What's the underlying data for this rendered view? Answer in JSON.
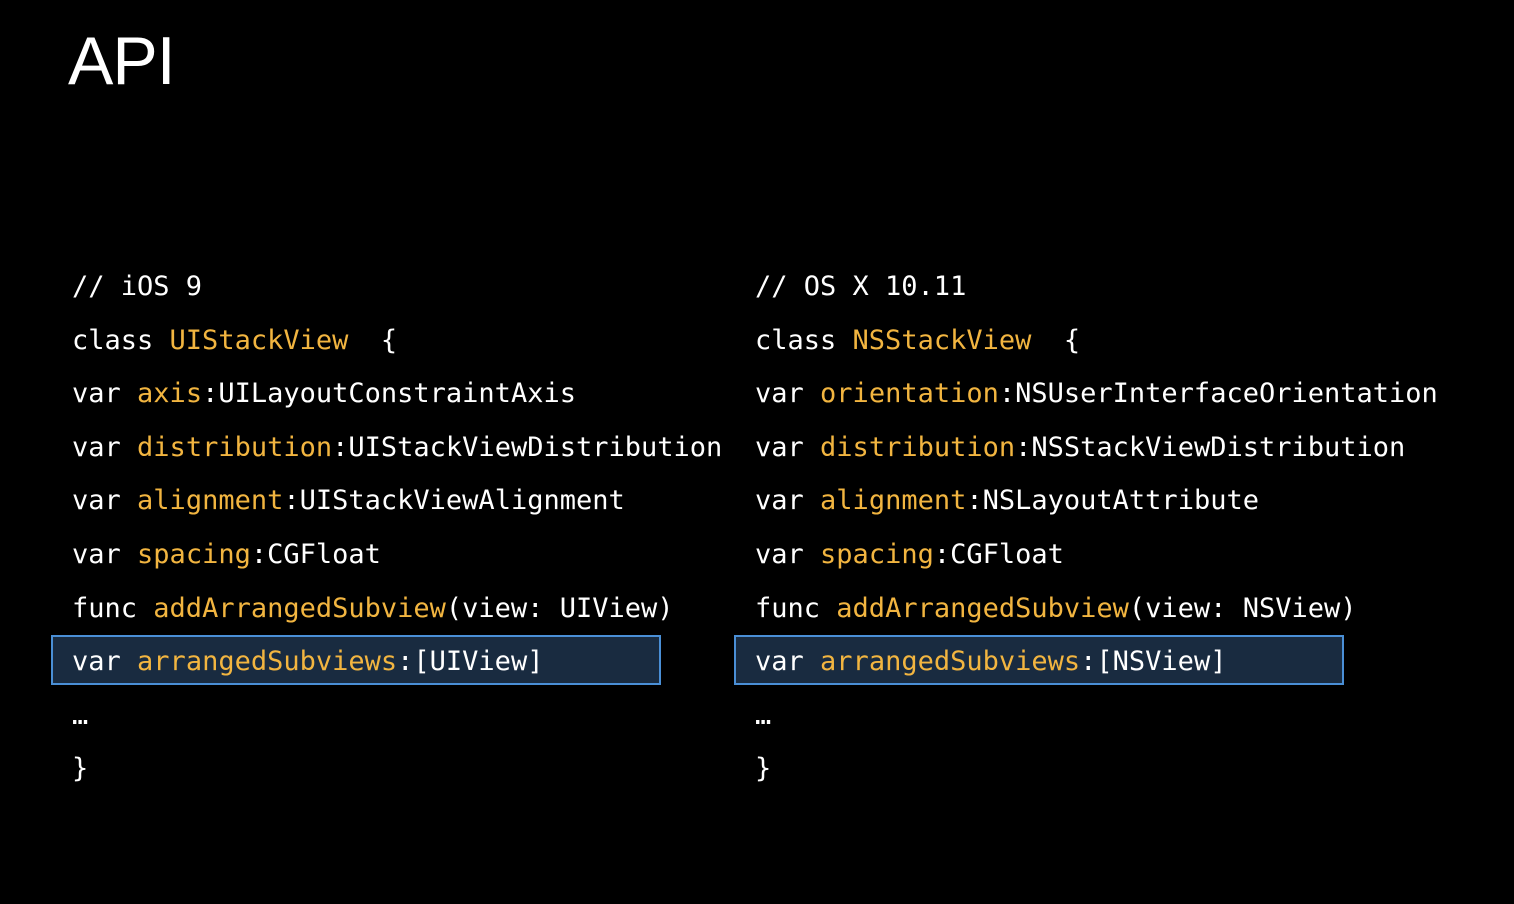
{
  "slide": {
    "title": "API"
  },
  "ios": {
    "comment": "// iOS 9",
    "class_kw": "class",
    "class_name": "UIStackView",
    "open_brace": "{",
    "lines": [
      {
        "kw": "var",
        "ident": "axis",
        "sep": ":",
        "type": "UILayoutConstraintAxis"
      },
      {
        "kw": "var",
        "ident": "distribution",
        "sep": ":",
        "type": "UIStackViewDistribution"
      },
      {
        "kw": "var",
        "ident": "alignment",
        "sep": ":",
        "type": "UIStackViewAlignment"
      },
      {
        "kw": "var",
        "ident": "spacing",
        "sep": ":",
        "type": "CGFloat"
      },
      {
        "kw": "func",
        "ident": "addArrangedSubview",
        "sep": "",
        "type": "(view: UIView)"
      },
      {
        "kw": "var",
        "ident": "arrangedSubviews",
        "sep": ":",
        "type": "[UIView]"
      }
    ],
    "ellipsis": "…",
    "close_brace": "}"
  },
  "osx": {
    "comment": "// OS X 10.11",
    "class_kw": "class",
    "class_name": "NSStackView",
    "open_brace": "{",
    "lines": [
      {
        "kw": "var",
        "ident": "orientation",
        "sep": ":",
        "type": "NSUserInterfaceOrientation"
      },
      {
        "kw": "var",
        "ident": "distribution",
        "sep": ":",
        "type": "NSStackViewDistribution"
      },
      {
        "kw": "var",
        "ident": "alignment",
        "sep": ":",
        "type": "NSLayoutAttribute"
      },
      {
        "kw": "var",
        "ident": "spacing",
        "sep": ":",
        "type": "CGFloat"
      },
      {
        "kw": "func",
        "ident": "addArrangedSubview",
        "sep": "",
        "type": "(view: NSView)"
      },
      {
        "kw": "var",
        "ident": "arrangedSubviews",
        "sep": ":",
        "type": "[NSView]"
      }
    ],
    "ellipsis": "…",
    "close_brace": "}"
  },
  "colors": {
    "background": "#000000",
    "text": "#ffffff",
    "identifier": "#f2b540",
    "highlight_fill": "#192b40",
    "highlight_border": "#4a8fd6"
  }
}
